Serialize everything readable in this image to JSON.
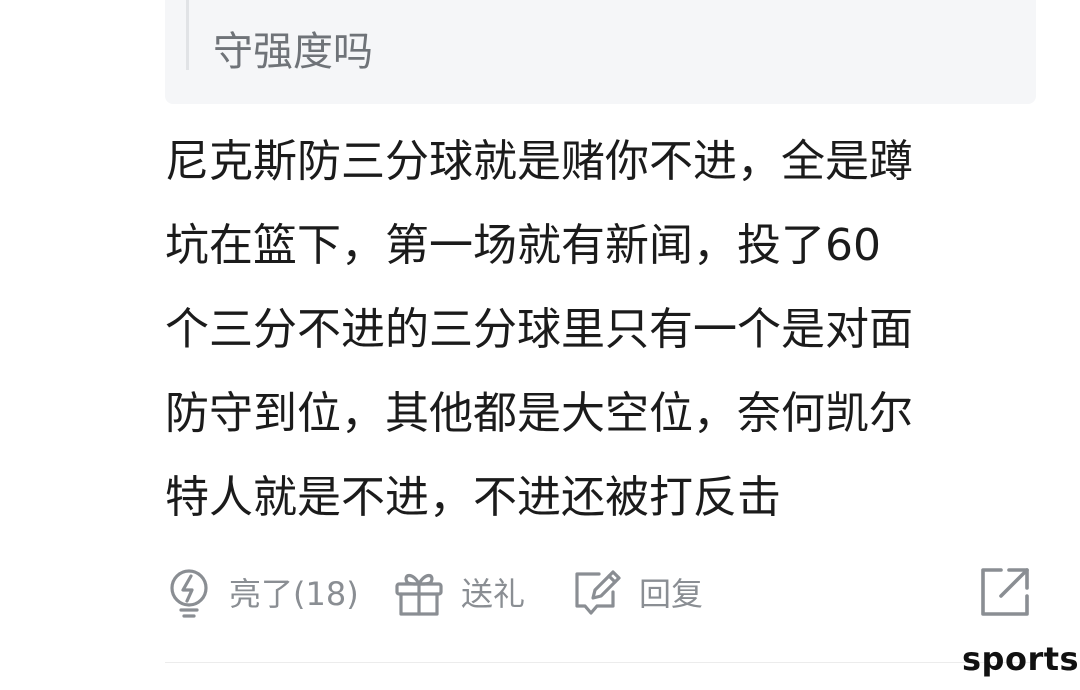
{
  "quote": {
    "text": "守强度吗"
  },
  "comment": {
    "lines": [
      "尼克斯防三分球就是赌你不进，全是蹲",
      "坑在篮下，第一场就有新闻，投了60",
      "个三分不进的三分球里只有一个是对面",
      "防守到位，其他都是大空位，奈何凯尔",
      "特人就是不进，不进还被打反击"
    ]
  },
  "actions": {
    "like_label": "亮了(18)",
    "gift_label": "送礼",
    "reply_label": "回复"
  },
  "watermark": {
    "text": "sports"
  },
  "colors": {
    "quote_bg": "#f5f6f8",
    "action_icon": "#8a8e93",
    "body_text": "#1b1b1b"
  },
  "icons": {
    "like": "lightbulb-icon",
    "gift": "gift-icon",
    "reply": "edit-icon",
    "share": "share-icon"
  }
}
